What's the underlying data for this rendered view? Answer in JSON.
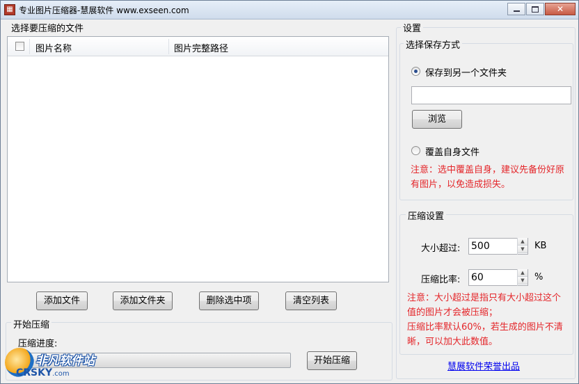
{
  "window": {
    "title": "专业图片压缩器-慧展软件 www.exseen.com",
    "controls": {
      "minimize": "",
      "maximize": "",
      "close": "✕"
    }
  },
  "files_group": {
    "label": "选择要压缩的文件",
    "columns": [
      "图片名称",
      "图片完整路径"
    ],
    "rows": []
  },
  "file_buttons": {
    "add_file": "添加文件",
    "add_folder": "添加文件夹",
    "delete_selected": "删除选中项",
    "clear_list": "清空列表"
  },
  "start_group": {
    "label": "开始压缩",
    "progress_label": "压缩进度:",
    "progress_value": 0,
    "start_button": "开始压缩"
  },
  "settings": {
    "label": "设置",
    "save_mode": {
      "label": "选择保存方式",
      "option_other_folder": "保存到另一个文件夹",
      "option_other_folder_checked": true,
      "folder_path": "",
      "browse_button": "浏览",
      "option_overwrite": "覆盖自身文件",
      "option_overwrite_checked": false,
      "warning": "注意：选中覆盖自身，建议先备份好原有图片，以免造成损失。"
    },
    "compression": {
      "label": "压缩设置",
      "size_label": "大小超过:",
      "size_value": "500",
      "size_unit": "KB",
      "ratio_label": "压缩比率:",
      "ratio_value": "60",
      "ratio_unit": "%",
      "note_line1": "注意：大小超过是指只有大小超过这个值的图片才会被压缩；",
      "note_line2": "压缩比率默认60%，若生成的图片不清晰，可以加大此数值。"
    },
    "credit_link": "慧展软件荣誉出品"
  },
  "watermark": {
    "brand": "非凡软件站",
    "domain": "CRSKY",
    "tld": ".com"
  },
  "colors": {
    "warning_text": "#e4262a",
    "link": "#0000ee",
    "window_bg": "#f0f0f0"
  }
}
